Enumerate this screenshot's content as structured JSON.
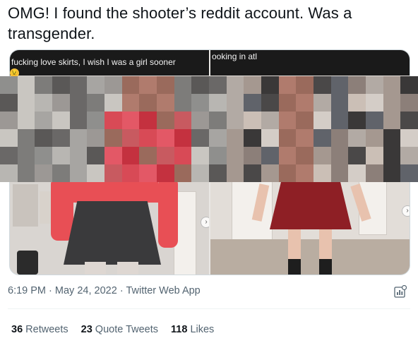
{
  "tweet": {
    "text": "OMG! I found the shooter’s reddit account. Was a transgender.",
    "media": {
      "left_caption": "fucking love skirts, I wish I was a girl sooner",
      "left_caption_emoji": "😉",
      "right_caption": "ooking in atl"
    },
    "time": "6:19 PM",
    "date": "May 24, 2022",
    "source": "Twitter Web App",
    "separator": "·",
    "stats": {
      "retweets_count": "36",
      "retweets_label": "Retweets",
      "quotes_count": "23",
      "quotes_label": "Quote Tweets",
      "likes_count": "118",
      "likes_label": "Likes"
    }
  },
  "colors": {
    "text": "#0f1419",
    "secondary": "#536471",
    "border": "#cfd9de",
    "divider": "#eff3f4"
  },
  "icons": {
    "analytics": "analytics-icon",
    "nav": "chevron-right-icon"
  }
}
